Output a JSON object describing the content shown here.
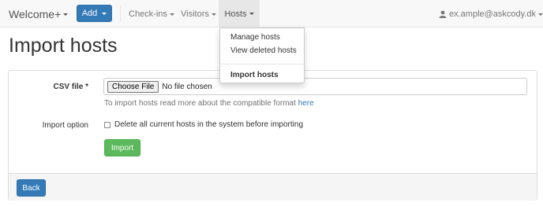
{
  "navbar": {
    "brand": "Welcome+",
    "add_label": "Add",
    "items": [
      {
        "label": "Check-ins"
      },
      {
        "label": "Visitors"
      },
      {
        "label": "Hosts"
      }
    ],
    "user": "ex.ample@askcody.dk",
    "user_icon": "user-icon"
  },
  "dropdown": {
    "items": [
      {
        "label": "Manage hosts"
      },
      {
        "label": "View deleted hosts"
      },
      {
        "label": "Import hosts"
      }
    ]
  },
  "page": {
    "title": "Import hosts"
  },
  "form": {
    "csv_label": "CSV file *",
    "choose_file": "Choose File",
    "no_file": "No file chosen",
    "help_text": "To import hosts read more about the compatible format ",
    "help_link": "here",
    "import_option_label": "Import option",
    "delete_checkbox_label": "Delete all current hosts in the system before importing",
    "delete_checked": false,
    "import_button": "Import",
    "back_button": "Back"
  },
  "colors": {
    "primary": "#337ab7",
    "success": "#5cb85c",
    "navbar_bg": "#f8f8f8",
    "active_nav_bg": "#e7e7e7"
  }
}
